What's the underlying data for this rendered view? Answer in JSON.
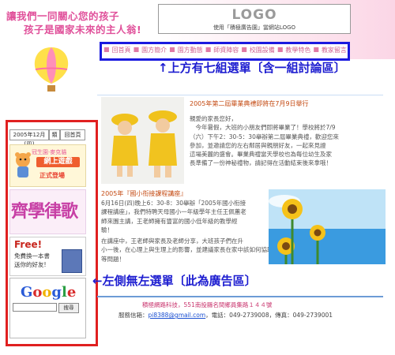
{
  "header": {
    "slogan_line1": "讓我們一同關心您的孩子",
    "slogan_line2": "孩子是國家未來的主人翁!",
    "logo_text": "LOGO",
    "logo_subtext": "使用「積極廣告園」當網站LOGO"
  },
  "nav": {
    "items": [
      "回首頁",
      "園方簡介",
      "園方動態",
      "師資陣容",
      "校園設備",
      "教學特色",
      "教家留言"
    ],
    "separator": "■"
  },
  "annotations": {
    "top": "↑上方有七組選單〔含一組討論區〕",
    "left": "←左側無左選單〔此為廣告區〕"
  },
  "sidebar": {
    "date": "2005年12月[四]",
    "book_button": "類",
    "home_button": "回首頁",
    "ad_game_top": "冠生園·麥克貓",
    "ad_game_mid": "網上遊戲",
    "ad_game_bottom": "正式登場",
    "ad_song": "齊學律歌",
    "ad_free_title": "Free!",
    "ad_free_line1": "免費換一本書",
    "ad_free_line2": "送你的好友!",
    "google_logo": "Google",
    "google_search_button": "搜尋"
  },
  "articles": [
    {
      "title": "2005年第二屆畢業典禮即將在7月9日舉行",
      "body": [
        "親愛的家長您好，",
        "　今年暑假，大班的小朋友們即將畢業了！學校將於7/9",
        "（六）下午2：30-5：30舉辦第二屆畢業典禮，歡迎您來",
        "參加，並邀請您的左右鄰居與親朋好友，一起來見證",
        "這場美麗的盛會。畢業典禮當天學校也為每位幼生及家",
        "長準備了一份神秘禮物，請記得在活動結束後來拿哦！"
      ]
    },
    {
      "title": "2005年『國小衔接課程講座』",
      "body": [
        "6月16日(四)晚上6：30-8：30舉辦「2005年國小衔接",
        "課程講座」，我們特聘天母國小一年級學年主任王佩蕙老",
        "師來園主講，王老師擁有豐富的國小低年級的教學經",
        "驗！"
      ],
      "body2": [
        "在講座中，王老師與家長及老師分享，大班孩子們在升",
        "小一後，在心理上與生理上的影響，並建議家長在家中該如何協助孩子適應小學生活",
        "等問題！"
      ]
    }
  ],
  "footer": {
    "line1": "積極網路科技，551南投縣名間鄉員集路１４４號",
    "line2_prefix": "服務信箱：",
    "email": "pi8388@gmail.com",
    "line2_suffix": "，電話：049-2739008，傳真：049-2739001"
  },
  "colors": {
    "nav_border": "#1a1adf",
    "sidebar_border": "#e02020",
    "annotation": "#1c1cd0",
    "article_title": "#c44a12"
  }
}
